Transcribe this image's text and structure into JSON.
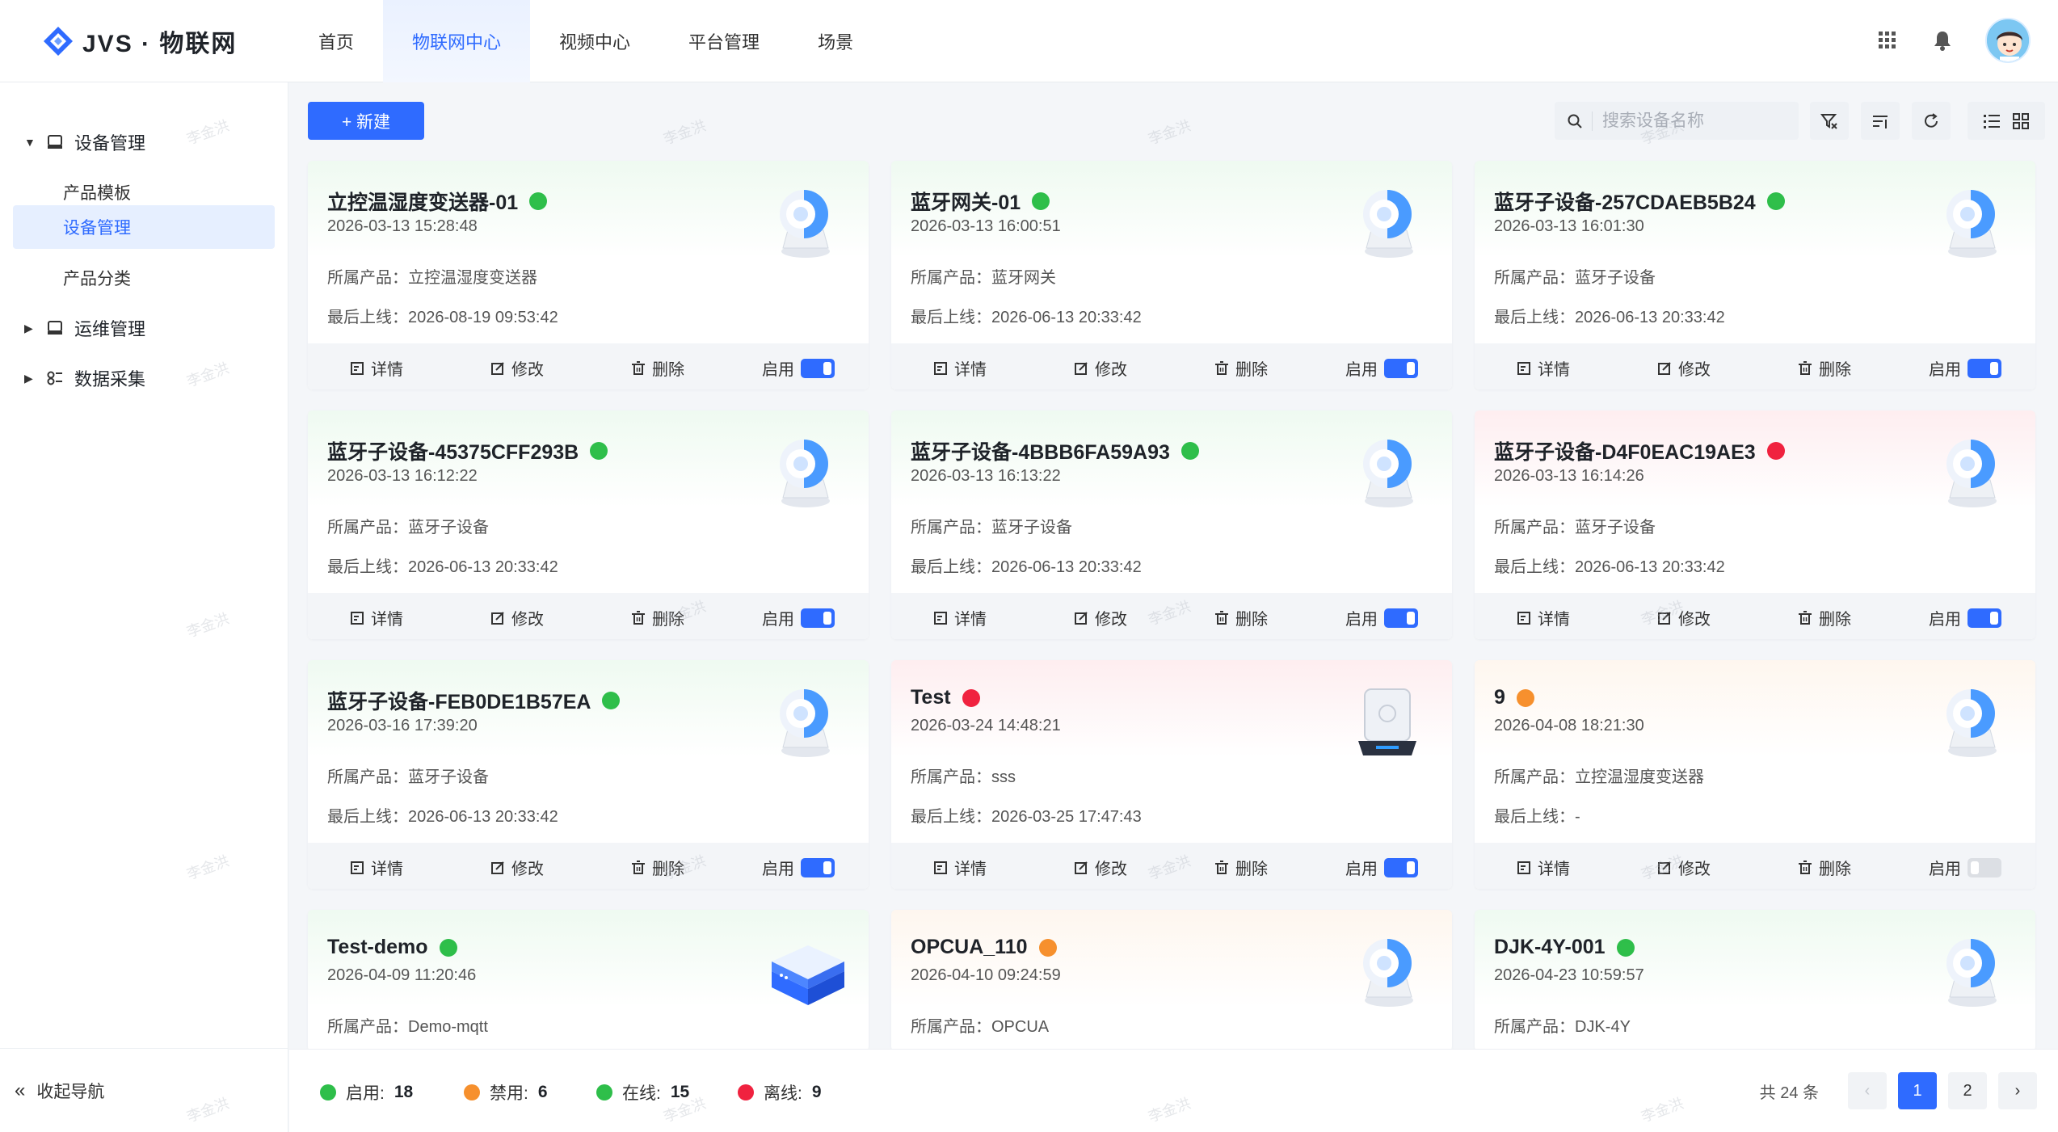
{
  "app": {
    "logo_text": "JVS · 物联网",
    "colors": {
      "accent": "#2f6bff",
      "online": "#2fbf4a",
      "offline": "#f0223f",
      "disabled": "#f7902e"
    }
  },
  "nav": {
    "items": [
      {
        "label": "首页",
        "active": false
      },
      {
        "label": "物联网中心",
        "active": true
      },
      {
        "label": "视频中心",
        "active": false
      },
      {
        "label": "平台管理",
        "active": false
      },
      {
        "label": "场景",
        "active": false
      }
    ]
  },
  "header_icons": [
    "apps-grid-icon",
    "bell-icon",
    "user-avatar"
  ],
  "sidebar": {
    "groups": [
      {
        "label": "设备管理",
        "expanded": true,
        "icon": "device-icon"
      },
      {
        "label": "运维管理",
        "expanded": false,
        "icon": "device-icon"
      },
      {
        "label": "数据采集",
        "expanded": false,
        "icon": "data-icon"
      }
    ],
    "sub_items": [
      {
        "label": "产品模板",
        "active": false
      },
      {
        "label": "设备管理",
        "active": true
      },
      {
        "label": "产品分类",
        "active": false
      }
    ],
    "collapse_label": "收起导航"
  },
  "toolbar": {
    "new_label": "+ 新建",
    "search_placeholder": "搜索设备名称"
  },
  "card_labels": {
    "product_prefix": "所属产品：",
    "last_online_prefix": "最后上线：",
    "detail": "详情",
    "edit": "修改",
    "delete": "删除",
    "enable": "启用"
  },
  "devices": [
    {
      "name": "立控温湿度变送器-01",
      "status": "online",
      "created": "2026-03-13 15:28:48",
      "product": "立控温湿度变送器",
      "last_online": "2026-08-19 09:53:42",
      "enabled": true,
      "image": "camera"
    },
    {
      "name": "蓝牙网关-01",
      "status": "online",
      "created": "2026-03-13 16:00:51",
      "product": "蓝牙网关",
      "last_online": "2026-06-13 20:33:42",
      "enabled": true,
      "image": "camera"
    },
    {
      "name": "蓝牙子设备-257CDAEB5B24",
      "status": "online",
      "created": "2026-03-13 16:01:30",
      "product": "蓝牙子设备",
      "last_online": "2026-06-13 20:33:42",
      "enabled": true,
      "image": "camera"
    },
    {
      "name": "蓝牙子设备-45375CFF293B",
      "status": "online",
      "created": "2026-03-13 16:12:22",
      "product": "蓝牙子设备",
      "last_online": "2026-06-13 20:33:42",
      "enabled": true,
      "image": "camera"
    },
    {
      "name": "蓝牙子设备-4BBB6FA59A93",
      "status": "online",
      "created": "2026-03-13 16:13:22",
      "product": "蓝牙子设备",
      "last_online": "2026-06-13 20:33:42",
      "enabled": true,
      "image": "camera"
    },
    {
      "name": "蓝牙子设备-D4F0EAC19AE3",
      "status": "offline",
      "created": "2026-03-13 16:14:26",
      "product": "蓝牙子设备",
      "last_online": "2026-06-13 20:33:42",
      "enabled": true,
      "image": "camera"
    },
    {
      "name": "蓝牙子设备-FEB0DE1B57EA",
      "status": "online",
      "created": "2026-03-16 17:39:20",
      "product": "蓝牙子设备",
      "last_online": "2026-06-13 20:33:42",
      "enabled": true,
      "image": "camera"
    },
    {
      "name": "Test",
      "status": "offline",
      "created": "2026-03-24 14:48:21",
      "product": "sss",
      "last_online": "2026-03-25 17:47:43",
      "enabled": true,
      "image": "gateway"
    },
    {
      "name": "9",
      "status": "disabled",
      "created": "2026-04-08 18:21:30",
      "product": "立控温湿度变送器",
      "last_online": "-",
      "enabled": false,
      "image": "camera"
    },
    {
      "name": "Test-demo",
      "status": "online",
      "created": "2026-04-09 11:20:46",
      "product": "Demo-mqtt",
      "last_online": "",
      "enabled": true,
      "image": "server"
    },
    {
      "name": "OPCUA_110",
      "status": "disabled",
      "created": "2026-04-10 09:24:59",
      "product": "OPCUA",
      "last_online": "",
      "enabled": true,
      "image": "camera"
    },
    {
      "name": "DJK-4Y-001",
      "status": "online",
      "created": "2026-04-23 10:59:57",
      "product": "DJK-4Y",
      "last_online": "",
      "enabled": true,
      "image": "camera"
    }
  ],
  "stats": [
    {
      "label": "启用:",
      "value": "18",
      "status": "online"
    },
    {
      "label": "禁用:",
      "value": "6",
      "status": "disabled"
    },
    {
      "label": "在线:",
      "value": "15",
      "status": "online"
    },
    {
      "label": "离线:",
      "value": "9",
      "status": "offline"
    }
  ],
  "pagination": {
    "total_text": "共 24 条",
    "prev": "‹",
    "pages": [
      "1",
      "2"
    ],
    "current": "1",
    "next": "›"
  },
  "watermark": "李金洪"
}
